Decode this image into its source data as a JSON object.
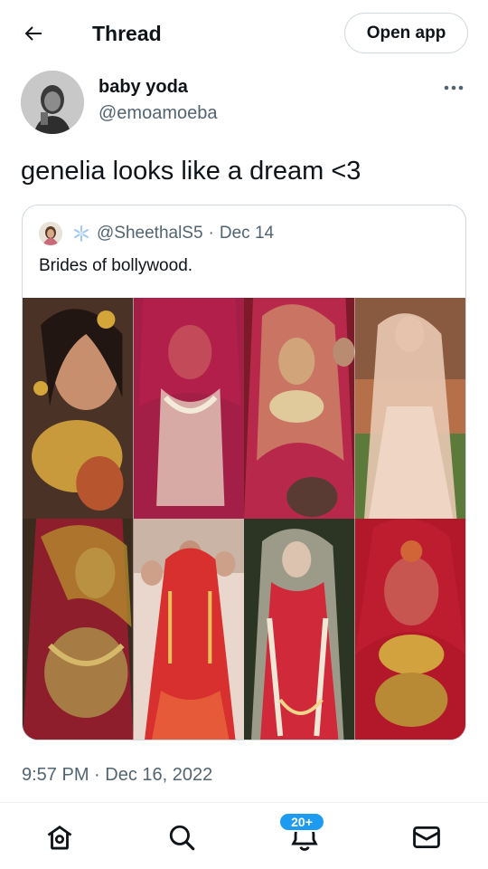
{
  "header": {
    "title": "Thread",
    "open_app_label": "Open app",
    "back_icon": "arrow-left-icon"
  },
  "tweet": {
    "author_name": "baby yoda",
    "author_handle": "@emoamoeba",
    "text": "genelia looks like a dream <3",
    "timestamp": "9:57 PM · Dec 16, 2022"
  },
  "quote": {
    "handle": "@SheethalS5",
    "separator": "·",
    "date": "Dec 14",
    "text": "Brides of bollywood.",
    "badge_icon": "snowflake-icon"
  },
  "nav": {
    "items": [
      "home-icon",
      "search-icon",
      "notifications-icon",
      "messages-icon"
    ],
    "notification_badge": "20+"
  },
  "colors": {
    "accent": "#1d9bf0",
    "secondary_text": "#536471",
    "border": "#cfd9de"
  }
}
